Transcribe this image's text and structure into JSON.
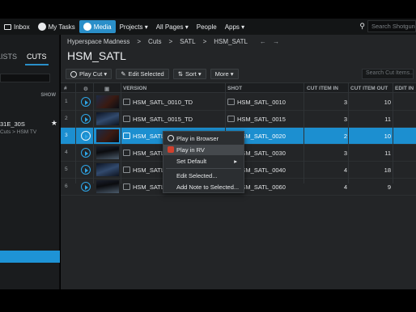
{
  "topbar": {
    "items": [
      {
        "label": "Inbox",
        "icon": "inbox-icon"
      },
      {
        "label": "My Tasks",
        "icon": "tasks-icon"
      },
      {
        "label": "Media",
        "icon": "media-play-icon",
        "active": true
      },
      {
        "label": "Projects ▾"
      },
      {
        "label": "All Pages ▾"
      },
      {
        "label": "People"
      },
      {
        "label": "Apps ▾"
      }
    ],
    "search_placeholder": "Search Shotgun"
  },
  "sidebar": {
    "tabs": [
      "LISTS",
      "CUTS"
    ],
    "show_label": "SHOW",
    "item_title": "31E_30S",
    "item_sub": "Cuts > HSM TV",
    "favorite_icon": "star-icon"
  },
  "main": {
    "breadcrumbs": [
      "Hyperspace Madness",
      ">",
      "Cuts",
      ">",
      "SATL",
      ">",
      "HSM_SATL"
    ],
    "nav_arrows": "← →",
    "title": "HSM_SATL",
    "toolbar": {
      "play_cut": "Play Cut ▾",
      "edit_selected": "Edit Selected",
      "sort": "Sort ▾",
      "more": "More ▾",
      "search_placeholder": "Search Cut Items..."
    },
    "columns": {
      "num": "#",
      "version": "VERSION",
      "shot": "SHOT",
      "cut_in": "CUT ITEM IN",
      "cut_out": "CUT ITEM OUT",
      "edit_in": "EDIT IN"
    },
    "rows": [
      {
        "num": "1",
        "version": "HSM_SATL_0010_TD",
        "shot": "HSM_SATL_0010",
        "cut_in": "3",
        "cut_out": "10"
      },
      {
        "num": "2",
        "version": "HSM_SATL_0015_TD",
        "shot": "HSM_SATL_0015",
        "cut_in": "3",
        "cut_out": "11"
      },
      {
        "num": "3",
        "version": "HSM_SATL_",
        "shot": "HSM_SATL_0020",
        "cut_in": "2",
        "cut_out": "10",
        "selected": true
      },
      {
        "num": "4",
        "version": "HSM_SATL_",
        "shot": "HSM_SATL_0030",
        "cut_in": "3",
        "cut_out": "11"
      },
      {
        "num": "5",
        "version": "HSM_SATL_",
        "shot": "HSM_SATL_0040",
        "cut_in": "4",
        "cut_out": "18"
      },
      {
        "num": "6",
        "version": "HSM_SATL_",
        "shot": "HSM_SATL_0060",
        "cut_in": "4",
        "cut_out": "9"
      }
    ]
  },
  "context_menu": {
    "items": [
      {
        "label": "Play in Browser",
        "icon": "play-browser-icon"
      },
      {
        "label": "Play in RV",
        "icon": "rv-icon",
        "highlighted": true
      },
      {
        "label": "Set Default",
        "submenu": "▸"
      },
      {
        "label": "Edit Selected..."
      },
      {
        "label": "Add Note to Selected..."
      }
    ]
  },
  "colors": {
    "accent": "#1e93d6",
    "background": "#232527",
    "topbar": "#131516"
  }
}
